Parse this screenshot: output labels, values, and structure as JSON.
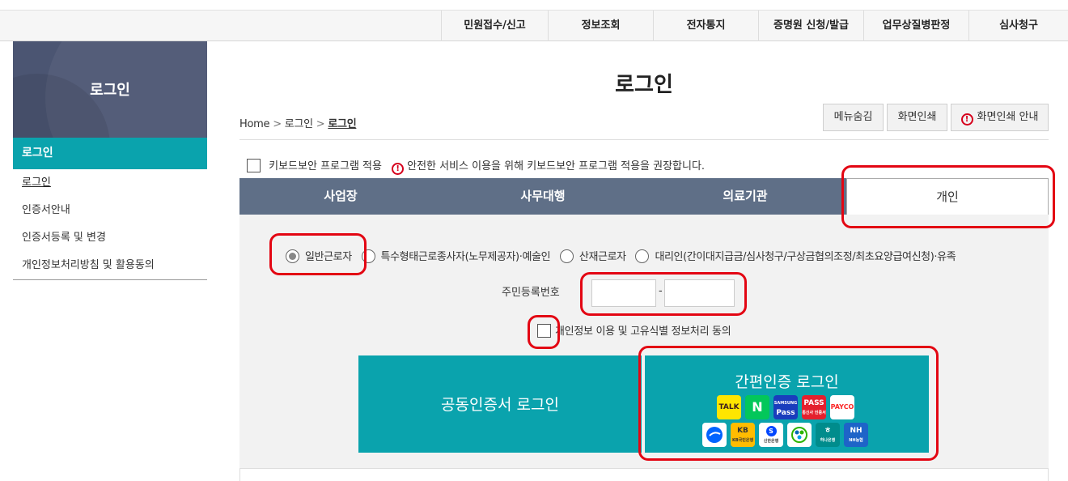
{
  "gnb": {
    "items": [
      "민원접수/신고",
      "정보조회",
      "전자통지",
      "증명원 신청/발급",
      "업무상질병판정",
      "심사청구"
    ]
  },
  "sidebar": {
    "banner_title": "로그인",
    "section_title": "로그인",
    "items": [
      "로그인",
      "인증서안내",
      "인증서등록 및 변경",
      "개인정보처리방침 및 활용동의"
    ]
  },
  "main": {
    "title": "로그인",
    "breadcrumb": {
      "home": "Home",
      "level1": "로그인",
      "current": "로그인",
      "separator": ">"
    },
    "buttons": {
      "hide_menu": "메뉴숨김",
      "print": "화면인쇄",
      "print_guide": "화면인쇄 안내"
    },
    "keyboard_security": {
      "label": "키보드보안 프로그램 적용",
      "notice": "안전한 서비스 이용을 위해 키보드보안 프로그램 적용을 권장합니다."
    },
    "tabs": [
      "사업장",
      "사무대행",
      "의료기관",
      "개인"
    ],
    "active_tab": "개인",
    "radio_options": [
      "일반근로자",
      "특수형태근로종사자(노무제공자)·예술인",
      "산재근로자",
      "대리인(간이대지급금/심사청구/구상금협의조정/최초요양급여신청)·유족"
    ],
    "selected_radio": "일반근로자",
    "rrn": {
      "label": "주민등록번호",
      "dash": "-",
      "front_value": "",
      "back_value": ""
    },
    "agree_label": "개인정보 이용 및 고유식별 정보처리 동의",
    "cert_login_label": "공동인증서 로그인",
    "simple_login_label": "간편인증 로그인",
    "simple_auth_providers": [
      "TALK",
      "N",
      "Pass",
      "PASS",
      "PAYCO",
      "",
      "KB",
      "S",
      "",
      "",
      "NH"
    ],
    "simple_auth_sublabels": [
      "SAMSUNG",
      "통신사 인증서",
      "KB국민은행",
      "신한은행",
      "하나은행",
      "NH농협"
    ]
  },
  "colors": {
    "teal": "#0aa3ad",
    "tab_bar": "#5f6f87",
    "sidebar_banner": "#4b5572",
    "highlight_red": "#e30613"
  }
}
